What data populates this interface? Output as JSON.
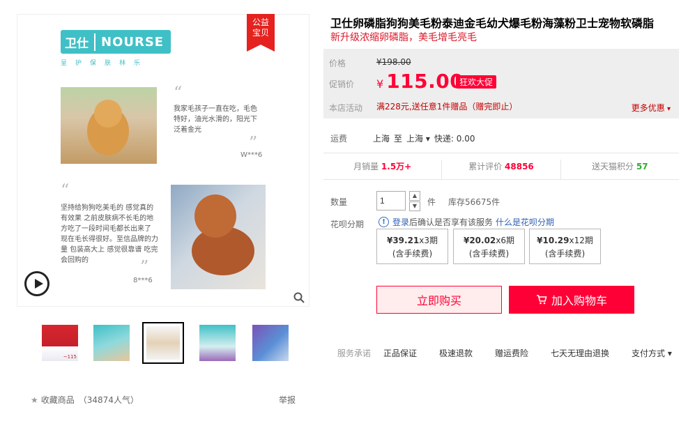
{
  "gallery": {
    "badge": [
      "公益",
      "宝贝"
    ],
    "brand": {
      "mark": "卫仕",
      "name": "NOURSE",
      "slogan": "呈护保肤林乐"
    },
    "review1": {
      "text": "我家毛孩子一直在吃，毛色特好，油光水滑的，阳光下泛着金光",
      "reviewer": "W***6"
    },
    "review2": {
      "text": "坚持给狗狗吃美毛的 感觉真的有效果 之前皮肤病不长毛的地方吃了一段时间毛都长出来了 现在毛长得很好。至信品牌的力量 包装高大上 感觉很靠谱 吃完会回购的",
      "reviewer": "8***6"
    },
    "thumb_label": "~115"
  },
  "favorites": {
    "label": "收藏商品",
    "count": "（34874人气）"
  },
  "report": "举报",
  "product": {
    "title": "卫仕卵磷脂狗狗美毛粉泰迪金毛幼犬爆毛粉海藻粉卫士宠物软磷脂",
    "subtitle": "新升级浓缩卵磷脂，美毛增毛亮毛"
  },
  "pricing": {
    "price_label": "价格",
    "original": "¥198.00",
    "promo_label": "促销价",
    "currency": "¥",
    "promo_price": "115.00",
    "promo_tag": "狂欢大促",
    "shop_label": "本店活动",
    "shop_activity": "满228元,送任意1件赠品（赠完即止）",
    "more_deals": "更多优惠"
  },
  "shipping": {
    "label": "运费",
    "from": "上海",
    "to_word": "至",
    "dest": "上海",
    "fee": "快递: 0.00"
  },
  "stats": {
    "monthly_label": "月销量",
    "monthly_value": "1.5万+",
    "reviews_label": "累计评价",
    "reviews_value": "48856",
    "points_label": "送天猫积分",
    "points_value": "57"
  },
  "quantity": {
    "label": "数量",
    "value": "1",
    "unit": "件",
    "stock": "库存56675件"
  },
  "huabei": {
    "label": "花呗分期",
    "login": "登录",
    "info": "后确认是否享有该服务",
    "what": "什么是花呗分期",
    "plans": [
      {
        "amount": "¥39.21",
        "periods": "x3期",
        "fee": "(含手续费)"
      },
      {
        "amount": "¥20.02",
        "periods": "x6期",
        "fee": "(含手续费)"
      },
      {
        "amount": "¥10.29",
        "periods": "x12期",
        "fee": "(含手续费)"
      }
    ]
  },
  "actions": {
    "buy_now": "立即购买",
    "add_cart": "加入购物车"
  },
  "services": {
    "label": "服务承诺",
    "items": [
      "正品保证",
      "极速退款",
      "赠运费险",
      "七天无理由退换"
    ],
    "payment": "支付方式"
  },
  "colors": {
    "accent": "#ff0036",
    "teal": "#3fc0c6"
  }
}
